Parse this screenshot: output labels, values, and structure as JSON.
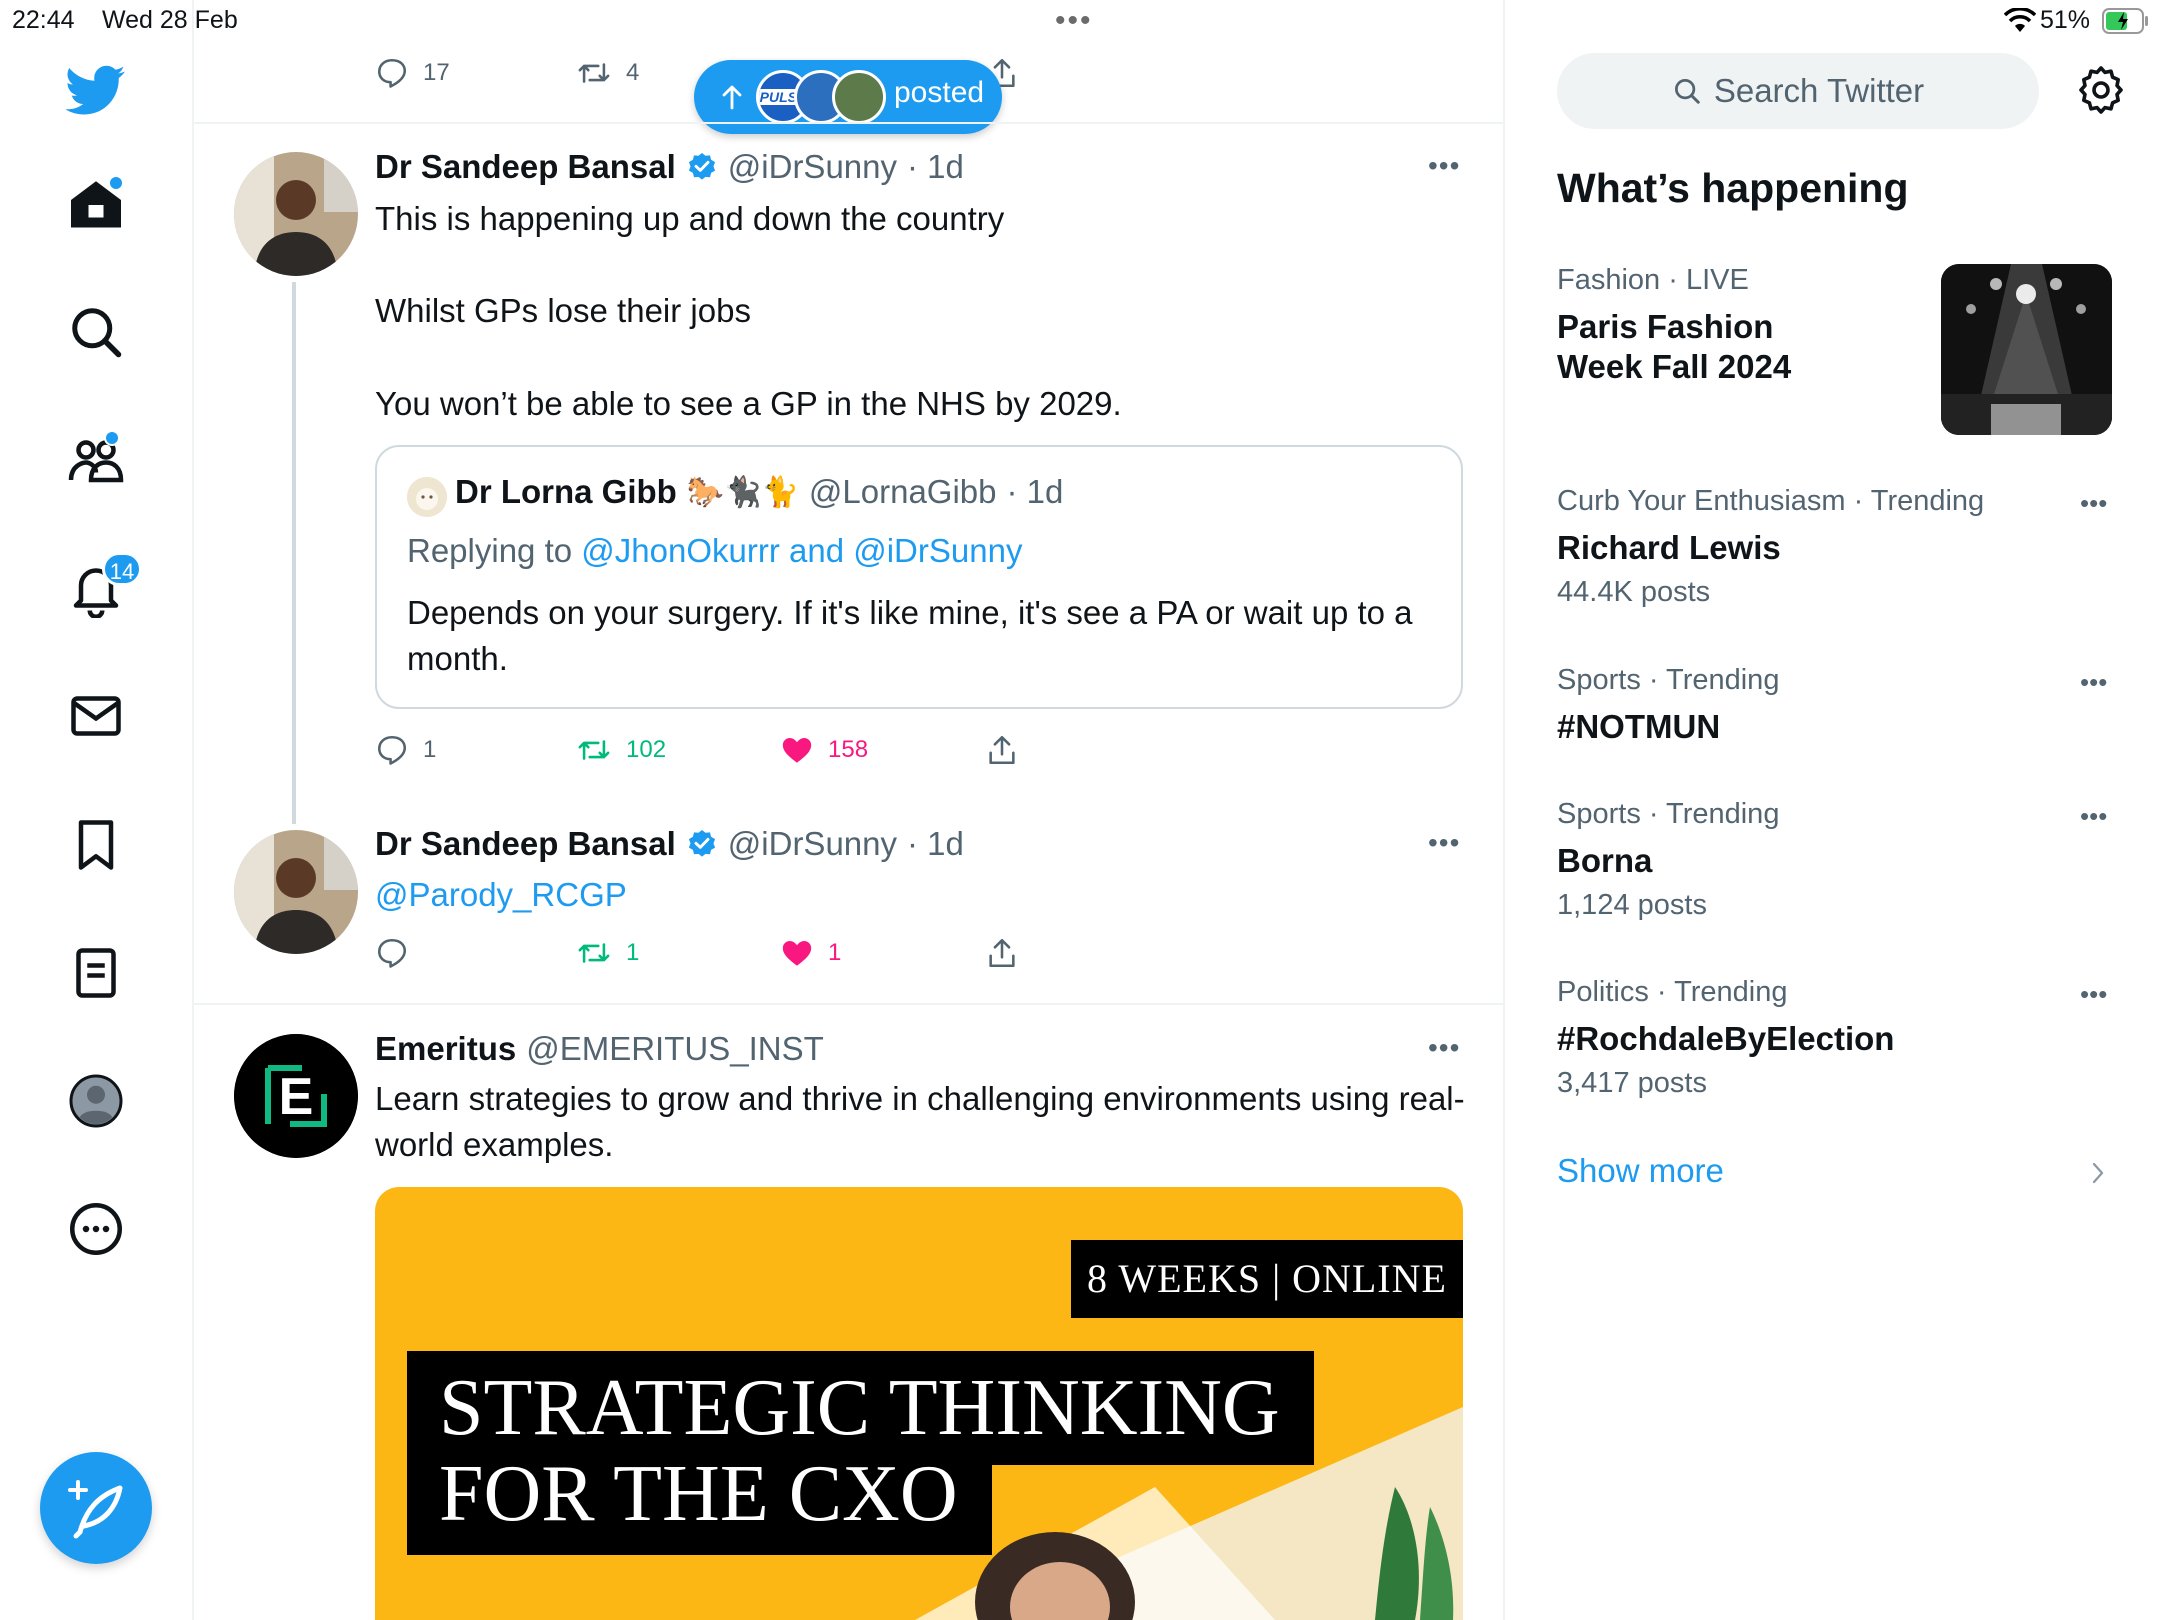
{
  "status_bar": {
    "time": "22:44",
    "date": "Wed 28 Feb",
    "battery_percent": "51%"
  },
  "nav": {
    "notification_count": "14",
    "items": [
      "twitter-logo",
      "home-icon",
      "search-icon",
      "communities-icon",
      "notifications-icon",
      "messages-icon",
      "bookmarks-icon",
      "lists-icon",
      "profile-icon",
      "more-icon"
    ]
  },
  "top_partial_tweet": {
    "reply_count": "17",
    "retweet_count": "4"
  },
  "posted_pill": {
    "label": "posted",
    "pulse_label": "PULSE"
  },
  "tweets": [
    {
      "name": "Dr Sandeep Bansal",
      "handle": "@iDrSunny",
      "time": "· 1d",
      "lines": [
        "This is happening up and down the country",
        "Whilst GPs lose their jobs",
        "You won’t be able to see a GP in the NHS by 2029."
      ],
      "quote": {
        "name": "Dr Lorna Gibb",
        "emoji": "🐎🐈‍⬛🐈",
        "handle": "@LornaGibb",
        "time": "· 1d",
        "replying_prefix": "Replying to",
        "replying_to": "@JhonOkurrr and @iDrSunny",
        "text": "Depends on your surgery. If it's like mine, it's see a PA or wait up to a month."
      },
      "reply_count": "1",
      "retweet_count": "102",
      "like_count": "158"
    },
    {
      "name": "Dr Sandeep Bansal",
      "handle": "@iDrSunny",
      "time": "· 1d",
      "text": "@Parody_RCGP",
      "reply_count": "",
      "retweet_count": "1",
      "like_count": "1"
    },
    {
      "name": "Emeritus",
      "handle": "@EMERITUS_INST",
      "text": "Learn strategies to grow and thrive in challenging environments using real-world examples.",
      "promo": {
        "badge": "8 WEEKS | ONLINE",
        "title_line1": "STRATEGIC THINKING",
        "title_line2": "FOR THE CXO"
      }
    }
  ],
  "sidebar": {
    "search_placeholder": "Search Twitter",
    "whats_happening": "What’s happening",
    "trends": [
      {
        "category": "Fashion · LIVE",
        "title": "Paris Fashion Week Fall 2024",
        "posts": ""
      },
      {
        "category": "Curb Your Enthusiasm · Trending",
        "title": "Richard Lewis",
        "posts": "44.4K posts"
      },
      {
        "category": "Sports · Trending",
        "title": "#NOTMUN",
        "posts": ""
      },
      {
        "category": "Sports · Trending",
        "title": "Borna",
        "posts": "1,124 posts"
      },
      {
        "category": "Politics · Trending",
        "title": "#RochdaleByElection",
        "posts": "3,417 posts"
      }
    ],
    "show_more": "Show more"
  },
  "colors": {
    "accent": "#1d9bf0",
    "retweet": "#00ba7c",
    "like": "#f91880",
    "secondary_text": "#536471",
    "border": "#eff3f4"
  }
}
